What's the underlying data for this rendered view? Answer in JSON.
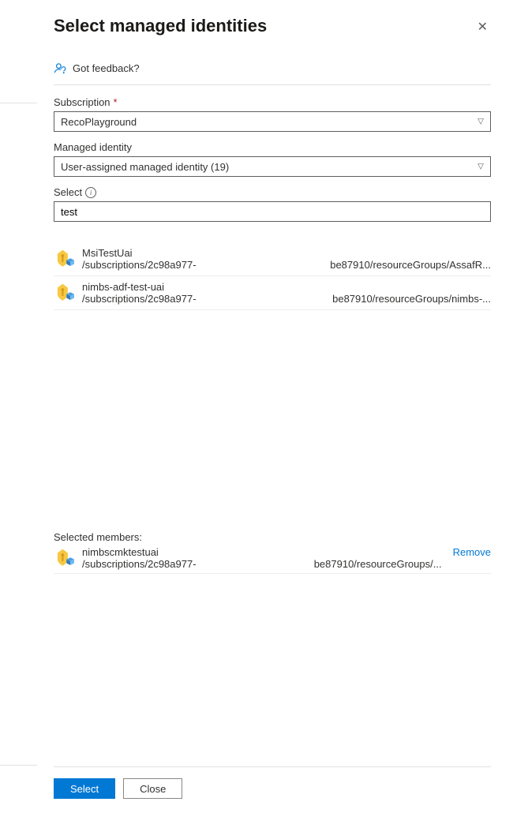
{
  "header": {
    "title": "Select managed identities"
  },
  "feedback": {
    "label": "Got feedback?"
  },
  "fields": {
    "subscription": {
      "label": "Subscription",
      "value": "RecoPlayground"
    },
    "managedIdentity": {
      "label": "Managed identity",
      "value": "User-assigned managed identity (19)"
    },
    "select": {
      "label": "Select",
      "value": "test"
    }
  },
  "results": [
    {
      "name": "MsiTestUai",
      "pathLeft": "/subscriptions/2c98a977-",
      "pathRight": "be87910/resourceGroups/AssafR..."
    },
    {
      "name": "nimbs-adf-test-uai",
      "pathLeft": "/subscriptions/2c98a977-",
      "pathRight": "be87910/resourceGroups/nimbs-..."
    }
  ],
  "selected": {
    "label": "Selected members:",
    "members": [
      {
        "name": "nimbscmktestuai",
        "pathLeft": "/subscriptions/2c98a977-",
        "pathRight": "be87910/resourceGroups/..."
      }
    ],
    "removeLabel": "Remove"
  },
  "footer": {
    "select": "Select",
    "close": "Close"
  }
}
